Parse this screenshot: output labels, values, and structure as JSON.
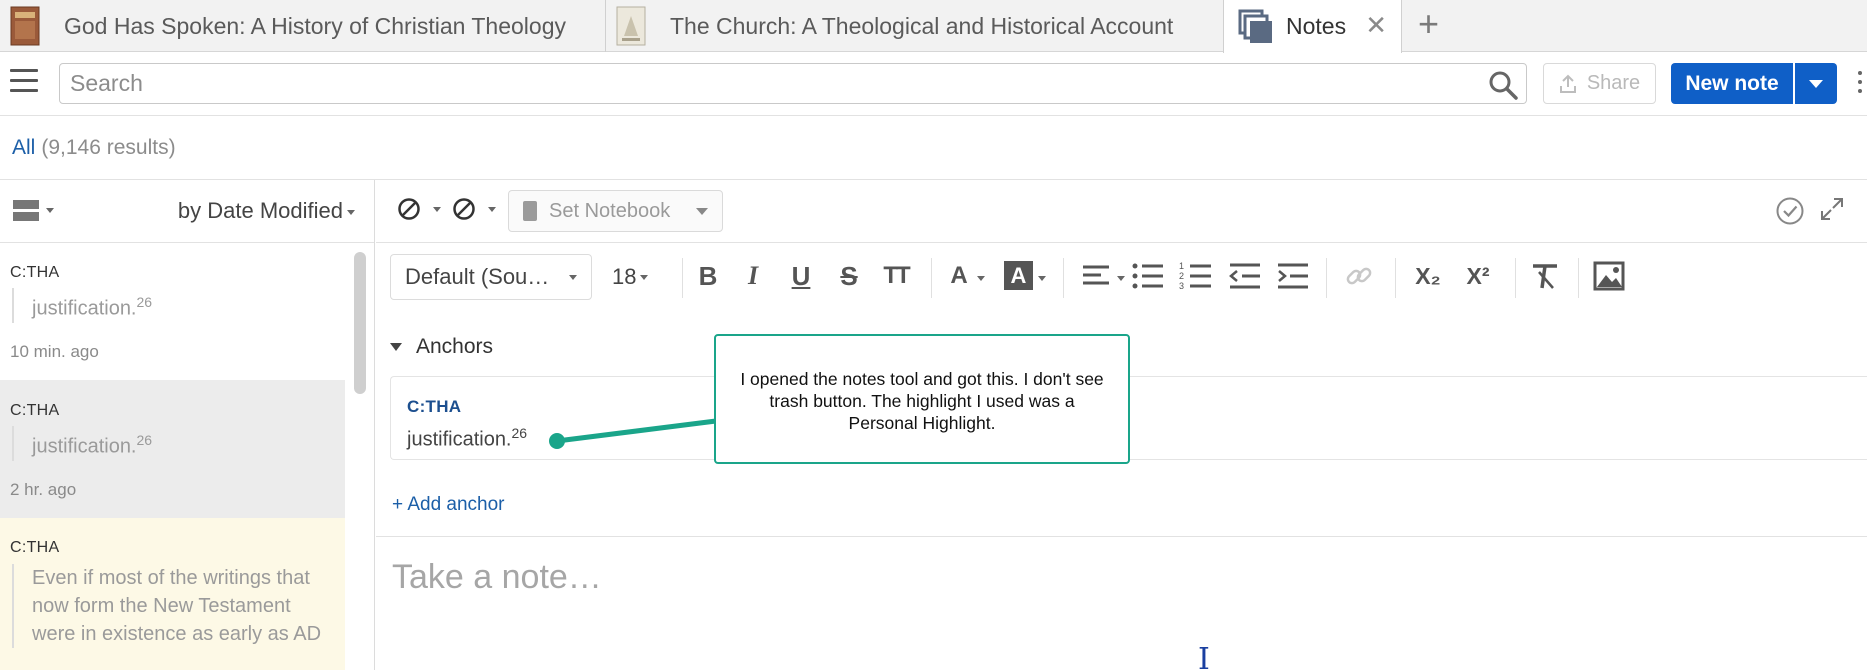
{
  "tabs": [
    {
      "label": "God Has Spoken: A History of Christian Theology",
      "icon": "book-cover-icon"
    },
    {
      "label": "The Church: A Theological and Historical Account",
      "icon": "book-cover-icon"
    },
    {
      "label": "Notes",
      "icon": "notes-stack-icon",
      "active": true,
      "close": "✕"
    }
  ],
  "toolbar": {
    "search_placeholder": "Search",
    "share_label": "Share",
    "new_note_label": "New note"
  },
  "results": {
    "all_label": "All",
    "count": "(9,146 results)"
  },
  "list": {
    "sort_label": "by Date Modified",
    "items": [
      {
        "source": "C:THA",
        "quote": "justification.",
        "sup": "26",
        "time": "10 min. ago"
      },
      {
        "source": "C:THA",
        "quote": "justification.",
        "sup": "26",
        "time": "2 hr. ago"
      },
      {
        "source": "C:THA",
        "quote_lines": [
          "Even if most of the writings that",
          "now form the New Testament",
          "were in existence as early as AD"
        ]
      }
    ]
  },
  "editor": {
    "notebook_label": "Set Notebook",
    "font_label": "Default (Sou…",
    "size_label": "18",
    "format_buttons": [
      {
        "name": "bold-button",
        "glyph": "B"
      },
      {
        "name": "italic-button",
        "glyph": "I"
      },
      {
        "name": "underline-button",
        "glyph": "U"
      },
      {
        "name": "strikethrough-button",
        "glyph": "S"
      },
      {
        "name": "text-size-button",
        "glyph": "TT"
      },
      {
        "name": "font-color-button",
        "glyph": "A"
      },
      {
        "name": "highlight-color-button",
        "glyph": "A"
      },
      {
        "name": "align-button",
        "glyph": "align"
      },
      {
        "name": "bullet-list-button",
        "glyph": "bullets"
      },
      {
        "name": "numbered-list-button",
        "glyph": "numbers"
      },
      {
        "name": "outdent-button",
        "glyph": "outdent"
      },
      {
        "name": "indent-button",
        "glyph": "indent"
      },
      {
        "name": "link-button",
        "glyph": "link"
      },
      {
        "name": "subscript-button",
        "glyph": "X₂"
      },
      {
        "name": "superscript-button",
        "glyph": "X²"
      },
      {
        "name": "clear-format-button",
        "glyph": "clear"
      },
      {
        "name": "insert-image-button",
        "glyph": "image"
      }
    ],
    "anchors_heading": "Anchors",
    "anchor": {
      "source": "C:THA",
      "quote": "justification.",
      "sup": "26"
    },
    "add_anchor_label": "+ Add anchor",
    "note_placeholder": "Take a note…"
  },
  "callout": {
    "text": "I opened the notes tool and got this. I don't see trash button. The highlight I used was a Personal Highlight."
  },
  "colors": {
    "accent": "#0f5fc7",
    "link": "#1c5fa8",
    "callout_border": "#1aa58a",
    "callout_connector": "#1aa58a",
    "highlighted_item_bg": "#fdf9e6",
    "selected_item_bg": "#ececec"
  }
}
